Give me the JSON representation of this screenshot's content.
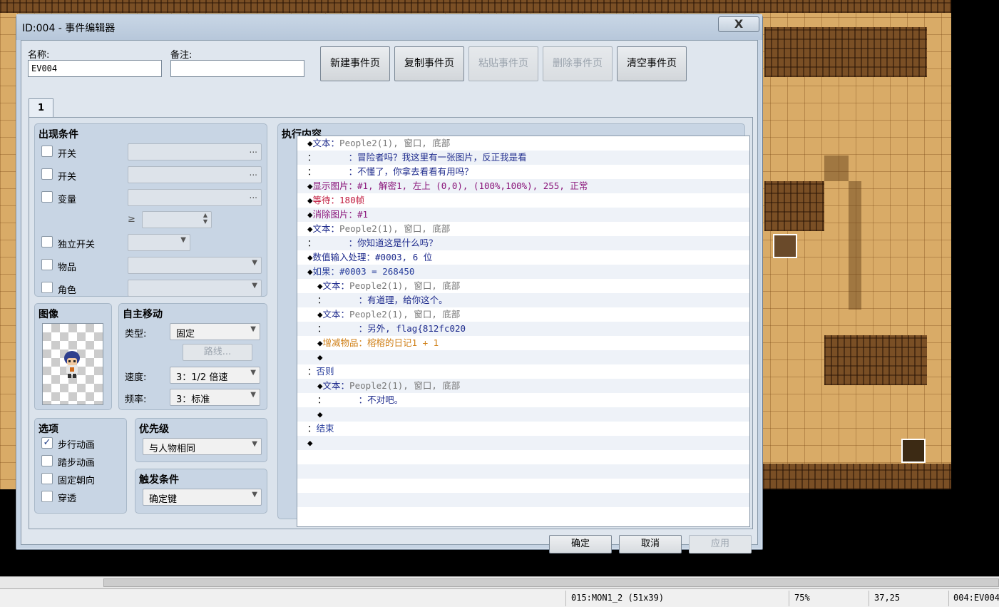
{
  "window": {
    "title": "ID:004 - 事件编辑器",
    "close": "X"
  },
  "fields": {
    "name_label": "名称:",
    "name_value": "EV004",
    "note_label": "备注:",
    "note_value": ""
  },
  "page_buttons": [
    "新建事件页",
    "复制事件页",
    "粘贴事件页",
    "删除事件页",
    "清空事件页"
  ],
  "tab": "1",
  "conditions": {
    "title": "出现条件",
    "switch1": "开关",
    "switch2": "开关",
    "variable": "变量",
    "gte": "≥",
    "self_switch": "独立开关",
    "item": "物品",
    "actor": "角色",
    "dots": "..."
  },
  "image": {
    "title": "图像"
  },
  "autonomous": {
    "title": "自主移动",
    "type_label": "类型:",
    "type_value": "固定",
    "route_button": "路线...",
    "speed_label": "速度:",
    "speed_value": "3：1/2 倍速",
    "freq_label": "频率:",
    "freq_value": "3：标准"
  },
  "options": {
    "title": "选项",
    "walking": "步行动画",
    "stepping": "踏步动画",
    "direction_fix": "固定朝向",
    "through": "穿透",
    "walking_checked": "✓"
  },
  "priority": {
    "title": "优先级",
    "value": "与人物相同"
  },
  "trigger": {
    "title": "触发条件",
    "value": "确定键"
  },
  "contents": {
    "title": "执行内容",
    "lines": [
      {
        "pre": "◆",
        "cmd": "文本：",
        "arg": "People2(1), 窗口, 底部",
        "cc": "navy",
        "ac": "gray",
        "indent": 0
      },
      {
        "pre": "：",
        "cmd": "      ：冒险者吗？我这里有一张图片，反正我是看",
        "arg": "",
        "cc": "navy",
        "ac": "",
        "indent": 0
      },
      {
        "pre": "：",
        "cmd": "      ：不懂了，你拿去看看有用吗？",
        "arg": "",
        "cc": "navy",
        "ac": "",
        "indent": 0
      },
      {
        "pre": "◆",
        "cmd": "显示图片：#1, 解密1, 左上 (0,0), (100%,100%), 255, 正常",
        "arg": "",
        "cc": "purple",
        "ac": "",
        "indent": 0
      },
      {
        "pre": "◆",
        "cmd": "等待：180帧",
        "arg": "",
        "cc": "red",
        "ac": "",
        "indent": 0
      },
      {
        "pre": "◆",
        "cmd": "消除图片：#1",
        "arg": "",
        "cc": "purple",
        "ac": "",
        "indent": 0
      },
      {
        "pre": "◆",
        "cmd": "文本：",
        "arg": "People2(1), 窗口, 底部",
        "cc": "navy",
        "ac": "gray",
        "indent": 0
      },
      {
        "pre": "：",
        "cmd": "      ：你知道这是什么吗？",
        "arg": "",
        "cc": "navy",
        "ac": "",
        "indent": 0
      },
      {
        "pre": "◆",
        "cmd": "数值输入处理：#0003, 6 位",
        "arg": "",
        "cc": "navy",
        "ac": "",
        "indent": 0
      },
      {
        "pre": "◆",
        "cmd": "如果：#0003 = 268450",
        "arg": "",
        "cc": "blue",
        "ac": "",
        "indent": 0
      },
      {
        "pre": "◆",
        "cmd": "文本：",
        "arg": "People2(1), 窗口, 底部",
        "cc": "navy",
        "ac": "gray",
        "indent": 1
      },
      {
        "pre": "：",
        "cmd": "      ：有道理，给你这个。",
        "arg": "",
        "cc": "navy",
        "ac": "",
        "indent": 1
      },
      {
        "pre": "◆",
        "cmd": "文本：",
        "arg": "People2(1), 窗口, 底部",
        "cc": "navy",
        "ac": "gray",
        "indent": 1
      },
      {
        "pre": "：",
        "cmd": "      ：另外, flag{812fc020",
        "arg": "",
        "cc": "navy",
        "ac": "",
        "indent": 1
      },
      {
        "pre": "◆",
        "cmd": "增减物品：榕榕的日记1 + 1",
        "arg": "",
        "cc": "orange",
        "ac": "",
        "indent": 1
      },
      {
        "pre": "◆",
        "cmd": "",
        "arg": "",
        "cc": "navy",
        "ac": "",
        "indent": 1
      },
      {
        "pre": "：",
        "cmd": "否则",
        "arg": "",
        "cc": "blue",
        "ac": "",
        "indent": 0
      },
      {
        "pre": "◆",
        "cmd": "文本：",
        "arg": "People2(1), 窗口, 底部",
        "cc": "navy",
        "ac": "gray",
        "indent": 1
      },
      {
        "pre": "：",
        "cmd": "      ：不对吧。",
        "arg": "",
        "cc": "navy",
        "ac": "",
        "indent": 1
      },
      {
        "pre": "◆",
        "cmd": "",
        "arg": "",
        "cc": "navy",
        "ac": "",
        "indent": 1
      },
      {
        "pre": "：",
        "cmd": "结束",
        "arg": "",
        "cc": "blue",
        "ac": "",
        "indent": 0
      },
      {
        "pre": "◆",
        "cmd": "",
        "arg": "",
        "cc": "navy",
        "ac": "",
        "indent": 0
      },
      {
        "pre": "",
        "cmd": "",
        "arg": "",
        "cc": "navy",
        "ac": "",
        "indent": 0
      },
      {
        "pre": "",
        "cmd": "",
        "arg": "",
        "cc": "navy",
        "ac": "",
        "indent": 0
      },
      {
        "pre": "",
        "cmd": "",
        "arg": "",
        "cc": "navy",
        "ac": "",
        "indent": 0
      },
      {
        "pre": "",
        "cmd": "",
        "arg": "",
        "cc": "navy",
        "ac": "",
        "indent": 0
      }
    ]
  },
  "footer": {
    "ok": "确定",
    "cancel": "取消",
    "apply": "应用"
  },
  "status": {
    "map": "015:MON1_2 (51x39)",
    "zoom": "75%",
    "coords": "37,25",
    "event": "004:EV004"
  }
}
